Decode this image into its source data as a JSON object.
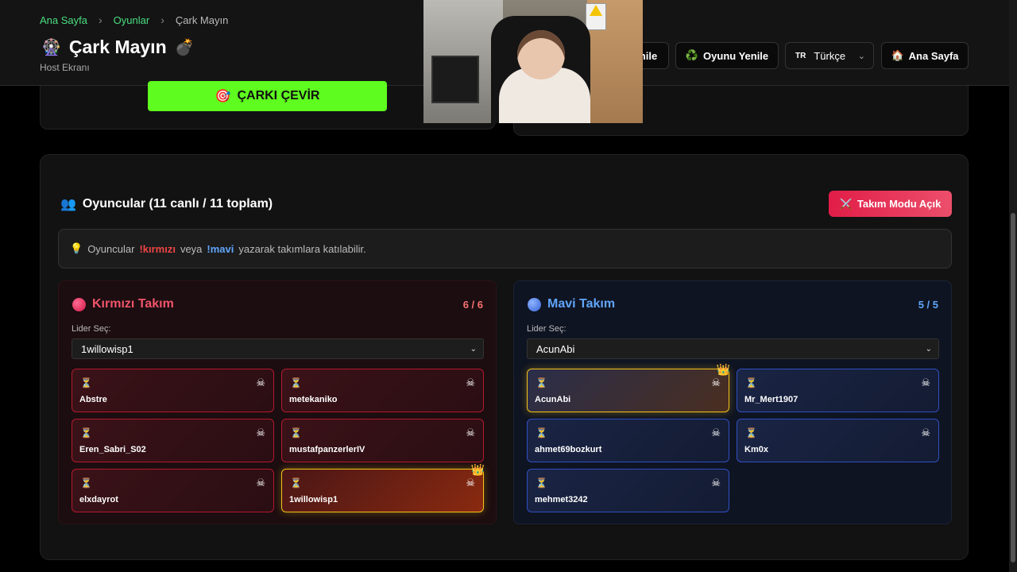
{
  "breadcrumb": {
    "home": "Ana Sayfa",
    "games": "Oyunlar",
    "current": "Çark Mayın"
  },
  "header": {
    "title": "Çark Mayın",
    "title_icon": "🎡",
    "title_suffix_icon": "💣",
    "subtitle": "Host Ekranı",
    "hidden_button_label": "nile",
    "renew_button": "Oyunu Yenile",
    "renew_icon": "♻️",
    "language": "Türkçe",
    "language_flag": "TR",
    "home_button": "Ana Sayfa",
    "home_icon": "🏠"
  },
  "spin": {
    "label": "ÇARKI ÇEVİR",
    "icon": "🎯"
  },
  "players": {
    "title": "Oyuncular (11 canlı / 11 toplam)",
    "title_icon": "👥",
    "team_mode_label": "Takım Modu Açık",
    "team_mode_icon": "⚔️",
    "info_icon": "💡",
    "info_prefix": "Oyuncular",
    "cmd_red": "!kırmızı",
    "info_mid": "veya",
    "cmd_blue": "!mavi",
    "info_suffix": "yazarak takımlara katılabilir."
  },
  "red_team": {
    "name": "Kırmızı Takım",
    "count": "6 / 6",
    "leader_label": "Lider Seç:",
    "leader": "1willowisp1",
    "color": "#b3192e",
    "players": [
      {
        "name": "Abstre",
        "leader": false
      },
      {
        "name": "metekaniko",
        "leader": false
      },
      {
        "name": "Eren_Sabri_S02",
        "leader": false
      },
      {
        "name": "mustafpanzerlerIV",
        "leader": false
      },
      {
        "name": "elxdayrot",
        "leader": false
      },
      {
        "name": "1willowisp1",
        "leader": true
      }
    ]
  },
  "blue_team": {
    "name": "Mavi Takım",
    "count": "5 / 5",
    "leader_label": "Lider Seç:",
    "leader": "AcunAbi",
    "color": "#2f4fc2",
    "players": [
      {
        "name": "AcunAbi",
        "leader": true
      },
      {
        "name": "Mr_Mert1907",
        "leader": false
      },
      {
        "name": "ahmet69bozkurt",
        "leader": false
      },
      {
        "name": "Km0x",
        "leader": false
      },
      {
        "name": "mehmet3242",
        "leader": false
      }
    ]
  },
  "icons": {
    "hourglass": "⏳",
    "kick": "☠",
    "crown": "👑",
    "chevron": "⌄",
    "breadcrumb_sep": "›"
  }
}
